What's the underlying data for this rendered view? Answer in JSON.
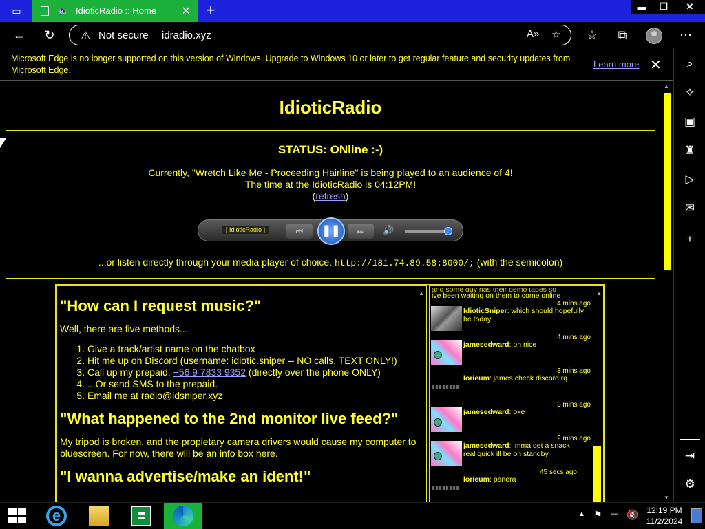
{
  "browser": {
    "tab_title": "IdioticRadio :: Home",
    "new_tab_label": "+",
    "address": {
      "security_label": "Not secure",
      "url": "idradio.xyz"
    },
    "window_buttons": {
      "minimize": "▬",
      "restore": "❐",
      "close": "✕"
    }
  },
  "infobar": {
    "message": "Microsoft Edge is no longer supported on this version of Windows. Upgrade to Windows 10 or later to get regular feature and security updates from Microsoft Edge.",
    "learn_more": "Learn more"
  },
  "site": {
    "title": "IdioticRadio",
    "status": "STATUS: ONline :-)",
    "now_playing": "Currently, \"Wretch Like Me - Proceeding Hairline\" is being played to an audience of 4!",
    "time_line": "The time at the IdioticRadio is 04:12PM!",
    "refresh_open": "(",
    "refresh_link": "refresh",
    "refresh_close": ")",
    "player_label": "-[ IdioticRadio ]-",
    "player_controls": {
      "prev": "⏮",
      "play_pause": "❚❚",
      "next": "⏭",
      "volume": "🔊"
    },
    "player_volume_level": 0.95,
    "direct_prefix": "...or listen directly through your media player of choice.",
    "direct_url": "http://181.74.89.58:8000/;",
    "direct_suffix": "(with the semicolon)"
  },
  "faq": {
    "q1": "\"How can I request music?\"",
    "q1_intro": "Well, there are five methods...",
    "methods": [
      "Give a track/artist name on the chatbox",
      "Hit me up on Discord (username: idiotic.sniper -- NO calls, TEXT ONLY!)",
      "Call up my prepaid:",
      "...Or send SMS to the prepaid.",
      "Email me at radio@idsniper.xyz"
    ],
    "phone": "+56 9 7833 9352",
    "phone_note": "(directly over the phone ONLY)",
    "q2": "\"What happened to the 2nd monitor live feed?\"",
    "q2_answer": "My tripod is broken, and the propietary camera drivers would cause my computer to bluescreen. For now, there will be an info box here.",
    "q3": "\"I wanna advertise/make an ident!\""
  },
  "chat": {
    "cut_line": "and some guy has their demo tapes so",
    "top_line": "ive been waiting on them to come online",
    "messages": [
      {
        "time": "4 mins ago",
        "user": "IdioticSniper",
        "text": ": which should hopefully be today"
      },
      {
        "time": "4 mins ago",
        "user": "jamesedward",
        "text": ": oh nice"
      },
      {
        "time": "3 mins ago",
        "user": "lorieum",
        "text": ": james check discord rq"
      },
      {
        "time": "3 mins ago",
        "user": "jamesedward",
        "text": ": oke"
      },
      {
        "time": "2 mins ago",
        "user": "jamesedward",
        "text": ": imma get a snack real quick ill be on standby"
      },
      {
        "time": "45 secs ago",
        "user": "lorieum",
        "text": ": panera"
      }
    ]
  },
  "taskbar": {
    "time": "12:19 PM",
    "date": "11/2/2024",
    "tray_icons": [
      "chevron-up-icon",
      "flag-icon",
      "network-icon",
      "volume-muted-icon",
      "keyboard-icon"
    ]
  },
  "colors": {
    "accent_yellow": "#ffff33",
    "tab_green": "#1bb13b",
    "titlebar_blue": "#1d22dd",
    "link": "#9e9eff"
  }
}
